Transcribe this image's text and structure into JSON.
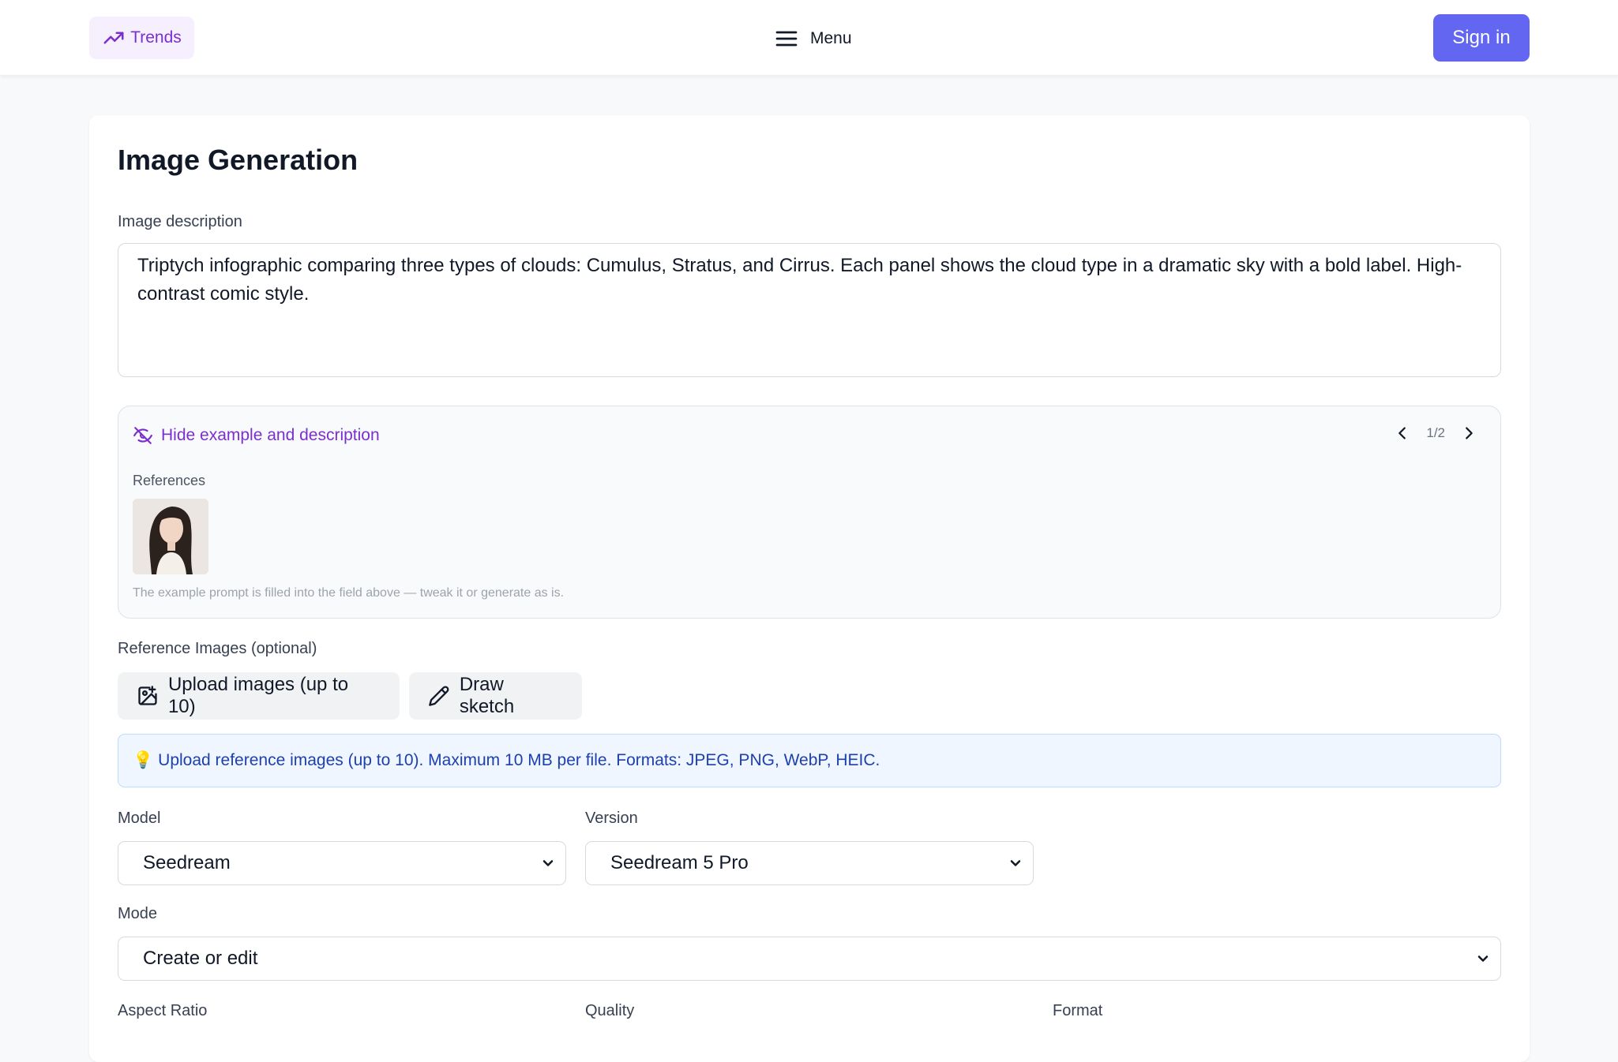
{
  "header": {
    "trends_label": "Trends",
    "menu_label": "Menu",
    "signin_label": "Sign in"
  },
  "page": {
    "title": "Image Generation",
    "prompt_label": "Image description",
    "prompt_value": "Triptych infographic comparing three types of clouds: Cumulus, Stratus, and Cirrus. Each panel shows the cloud type in a dramatic sky with a bold label. High-contrast comic style."
  },
  "example": {
    "hide_label": "Hide example and description",
    "pager": "1/2",
    "references_label": "References",
    "note": "The example prompt is filled into the field above — tweak it or generate as is."
  },
  "reference_images": {
    "label": "Reference Images (optional)",
    "upload_label": "Upload images (up to 10)",
    "sketch_label": "Draw sketch",
    "info_icon": "💡",
    "info_text": "Upload reference images (up to 10). Maximum 10 MB per file. Formats: JPEG, PNG, WebP, HEIC."
  },
  "model": {
    "label": "Model",
    "value": "Seedream"
  },
  "version": {
    "label": "Version",
    "value": "Seedream 5 Pro"
  },
  "mode": {
    "label": "Mode",
    "value": "Create or edit"
  },
  "bottom_labels": {
    "aspect_ratio": "Aspect Ratio",
    "quality": "Quality",
    "format": "Format"
  },
  "colors": {
    "accent": "#7b2fd0",
    "primary": "#6366f1",
    "info_bg": "#eff6ff",
    "info_text": "#1e40af"
  }
}
